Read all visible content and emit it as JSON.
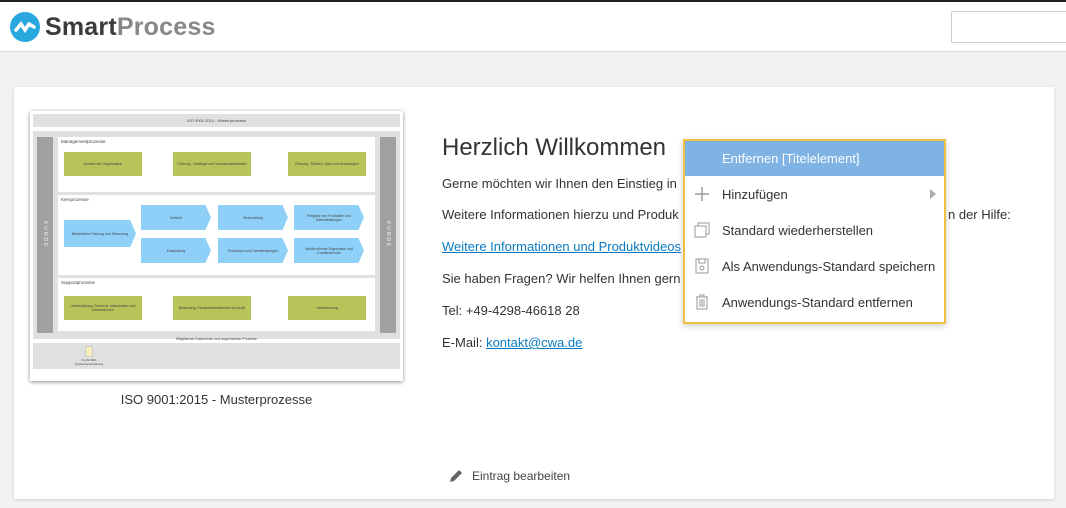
{
  "header": {
    "brand_part1": "Smart",
    "brand_part2": "Process"
  },
  "tile": {
    "caption": "ISO 9001:2015 - Musterprozesse",
    "diagram": {
      "title": "ISO 9001:2015 - Musterprozesse",
      "side_label": "KUNDE",
      "management": {
        "label": "Managementprozesse",
        "items": [
          "Kontext der Organisation",
          "Führung - Strategie und Verantwortlichkeiten",
          "Planung - Risiken, Ziele und Änderungen"
        ]
      },
      "core": {
        "label": "Kernprozesse",
        "items": [
          "Betriebliche Planung und Steuerung",
          "Vertrieb",
          "Beschaffung",
          "Freigabe von Produkten und Dienstleistungen",
          "Entwicklung",
          "Produktion und Dienstleistungen",
          "Nichtkonforme Ergebnisse und Kundenservice"
        ]
      },
      "support": {
        "label": "Supportprozesse",
        "items": [
          "Unterstützung, Personal, Infrastruktur und Informationen",
          "Bewertung, Kundenzufriedenheit und Audit",
          "Verbesserung"
        ]
      },
      "footer_label": "Mitgeltende Dokumente und angrenzende Prozesse",
      "doc": {
        "code": "01-01-SBA",
        "name": "Systembeschreibung"
      }
    }
  },
  "welcome": {
    "title": "Herzlich Willkommen",
    "line1": "Gerne möchten wir Ihnen den Einstieg in",
    "line2_start": "Weitere Informationen hierzu und Produk",
    "line2_end": "n der Hilfe:",
    "link": "Weitere Informationen und Produktvideos",
    "line3": "Sie haben Fragen? Wir helfen Ihnen gern",
    "tel": "Tel: +49-4298-46618 28",
    "email_label": "E-Mail: ",
    "email": "kontakt@cwa.de",
    "edit_label": "Eintrag bearbeiten"
  },
  "context_menu": {
    "header": "Entfernen [Titelelement]",
    "items": [
      {
        "label": "Hinzufügen",
        "icon": "plus-icon"
      },
      {
        "label": "Standard wiederherstellen",
        "icon": "windows-icon"
      },
      {
        "label": "Als Anwendungs-Standard speichern",
        "icon": "save-icon"
      },
      {
        "label": "Anwendungs-Standard entfernen",
        "icon": "trash-icon"
      }
    ]
  }
}
